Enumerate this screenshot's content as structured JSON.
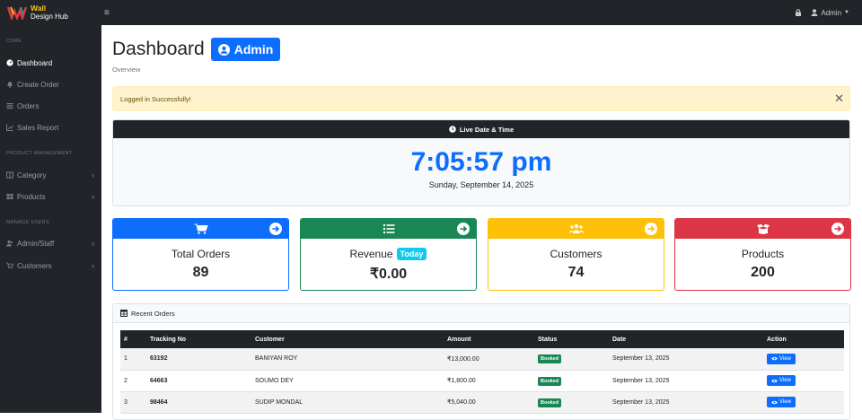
{
  "brand": {
    "line1": "Wall",
    "line2": "Design Hub"
  },
  "topbar": {
    "user_label": "Admin"
  },
  "sidebar": {
    "sections": [
      {
        "heading": "CORE"
      },
      {
        "heading": "PRODUCT MANAGEMENT"
      },
      {
        "heading": "MANAGE USERS"
      }
    ],
    "items": [
      {
        "label": "Dashboard",
        "icon": "gauge-icon"
      },
      {
        "label": "Create Order",
        "icon": "bell-icon"
      },
      {
        "label": "Orders",
        "icon": "list-icon"
      },
      {
        "label": "Sales Report",
        "icon": "chart-icon"
      },
      {
        "label": "Category",
        "icon": "columns-icon"
      },
      {
        "label": "Products",
        "icon": "grid-icon"
      },
      {
        "label": "Admin/Staff",
        "icon": "users-icon"
      },
      {
        "label": "Customers",
        "icon": "cart-icon"
      }
    ]
  },
  "page": {
    "title": "Dashboard",
    "badge": "Admin",
    "breadcrumb": "Overview"
  },
  "alert": {
    "message": "Logged in Successfully!"
  },
  "clock": {
    "heading": "Live Date & Time",
    "time": "7:05:57 pm",
    "date": "Sunday, September 14, 2025"
  },
  "stats": [
    {
      "label": "Total Orders",
      "value": "89",
      "color": "#0d6efd"
    },
    {
      "label": "Revenue",
      "badge": "Today",
      "value": "₹0.00",
      "color": "#198754"
    },
    {
      "label": "Customers",
      "value": "74",
      "color": "#ffc107"
    },
    {
      "label": "Products",
      "value": "200",
      "color": "#dc3545"
    }
  ],
  "orders": {
    "heading": "Recent Orders",
    "columns": [
      "#",
      "Tracking No",
      "Customer",
      "Amount",
      "Status",
      "Date",
      "Action"
    ],
    "rows": [
      {
        "n": "1",
        "tracking": "63192",
        "customer": "BANIYAN ROY",
        "amount": "₹13,000.00",
        "status": "Booked",
        "date": "September 13, 2025",
        "action": "View"
      },
      {
        "n": "2",
        "tracking": "64663",
        "customer": "SOUMO DEY",
        "amount": "₹1,800.00",
        "status": "Booked",
        "date": "September 13, 2025",
        "action": "View"
      },
      {
        "n": "3",
        "tracking": "98464",
        "customer": "SUDIP MONDAL",
        "amount": "₹5,040.00",
        "status": "Booked",
        "date": "September 13, 2025",
        "action": "View"
      }
    ]
  }
}
